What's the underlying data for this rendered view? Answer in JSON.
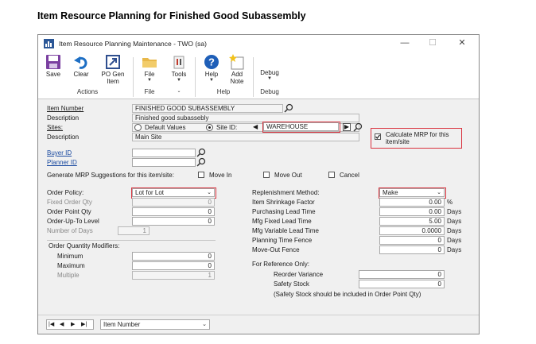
{
  "heading": "Item Resource Planning for Finished Good Subassembly",
  "window": {
    "title": "Item Resource Planning Maintenance  -  TWO (sa)",
    "min": "—",
    "max": "☐",
    "close": "✕"
  },
  "ribbon": {
    "buttons": {
      "save": "Save",
      "clear": "Clear",
      "po_gen": "PO Gen Item",
      "file": "File",
      "tools": "Tools",
      "help": "Help",
      "add_note": "Add Note",
      "debug": "Debug"
    },
    "groups": {
      "actions": "Actions",
      "file": "File",
      "help": "Help",
      "debug": "Debug"
    }
  },
  "form": {
    "item_number": {
      "label": "Item Number",
      "value": "FINISHED GOOD SUBASSEMBLY"
    },
    "description": {
      "label": "Description",
      "value": "Finished good subassebly"
    },
    "sites": {
      "label": "Sites:",
      "opt_default": "Default Values",
      "opt_site": "Site ID:",
      "value": "WAREHOUSE"
    },
    "site_description": {
      "label": "Description",
      "value": "Main Site"
    },
    "calc_mrp": {
      "label": "Calculate MRP for this item/site",
      "checked": true
    },
    "buyer_id": {
      "label": "Buyer ID",
      "value": ""
    },
    "planner_id": {
      "label": "Planner ID",
      "value": ""
    },
    "generate": {
      "label": "Generate MRP Suggestions for this item/site:",
      "move_in": "Move In",
      "move_out": "Move Out",
      "cancel": "Cancel"
    },
    "order_policy": {
      "label": "Order Policy:",
      "value": "Lot for Lot"
    },
    "fixed_order_qty": {
      "label": "Fixed Order Qty",
      "value": "0"
    },
    "order_point_qty": {
      "label": "Order Point Qty",
      "value": "0"
    },
    "order_up_to": {
      "label": "Order-Up-To Level",
      "value": "0"
    },
    "number_of_days": {
      "label": "Number of Days",
      "value": "1"
    },
    "oqm": {
      "legend": "Order Quantity Modifiers:",
      "minimum": "Minimum",
      "min_value": "0",
      "maximum": "Maximum",
      "max_value": "0",
      "multiple": "Multiple",
      "mult_value": "1"
    },
    "replenishment": {
      "label": "Replenishment Method:",
      "value": "Make"
    },
    "shrinkage": {
      "label": "Item Shrinkage Factor",
      "value": "0.00",
      "unit": "%"
    },
    "purchasing_lt": {
      "label": "Purchasing Lead Time",
      "value": "0.00",
      "unit": "Days"
    },
    "mfg_fixed_lt": {
      "label": "Mfg Fixed Lead Time",
      "value": "5.00",
      "unit": "Days"
    },
    "mfg_variable_lt": {
      "label": "Mfg Variable Lead Time",
      "value": "0.0000",
      "unit": "Days"
    },
    "planning_fence": {
      "label": "Planning Time Fence",
      "value": "0",
      "unit": "Days"
    },
    "move_out_fence": {
      "label": "Move-Out Fence",
      "value": "0",
      "unit": "Days"
    },
    "reference": {
      "label": "For Reference Only:",
      "reorder_label": "Reorder Variance",
      "reorder_value": "0",
      "safety_label": "Safety Stock",
      "safety_value": "0",
      "note": "(Safety Stock should be included in Order Point Qty)"
    }
  },
  "statusbar": {
    "nav": [
      "|◀",
      "◀",
      "▶",
      "▶|"
    ],
    "sort_by": "Item Number"
  }
}
